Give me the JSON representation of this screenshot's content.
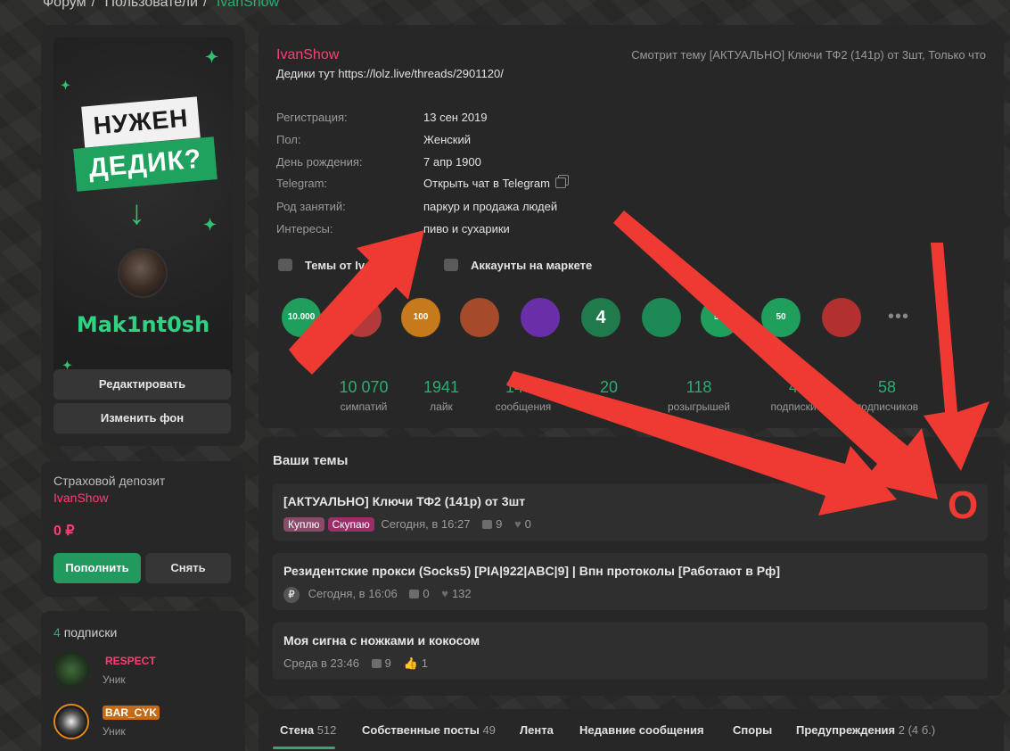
{
  "breadcrumb": [
    "Форум",
    "Пользователи",
    "IvanShow"
  ],
  "banner": {
    "line1": "НУЖЕН",
    "line2": "ДЕДИК?",
    "name": "Mak1nt0sh"
  },
  "left_buttons": {
    "edit": "Редактировать",
    "change_bg": "Изменить фон"
  },
  "deposit": {
    "title": "Страховой депозит",
    "user": "IvanShow",
    "amount": "0 ₽",
    "topup": "Пополнить",
    "withdraw": "Снять"
  },
  "subscriptions": {
    "count": "4",
    "label": "подписки",
    "items": [
      {
        "name": "RESPECT",
        "role": "Уник",
        "color": "#ff3e74"
      },
      {
        "name": "BAR_CYK",
        "role": "Уник",
        "color": "#ffffff"
      }
    ]
  },
  "profile": {
    "username": "IvanShow",
    "status": "Дедики тут https://lolz.live/threads/2901120/",
    "watching": "Смотрит тему [АКТУАЛЬНО] Ключи ТФ2 (141р) от 3шт, Только что",
    "info": [
      {
        "k": "Регистрация:",
        "v": "13 сен 2019"
      },
      {
        "k": "Пол:",
        "v": "Женский"
      },
      {
        "k": "День рождения:",
        "v": "7 апр 1900"
      },
      {
        "k": "Telegram:",
        "v": "Открыть чат в Telegram"
      },
      {
        "k": "Род занятий:",
        "v": "паркур и продажа людей"
      },
      {
        "k": "Интересы:",
        "v": "пиво и сухарики"
      }
    ],
    "link_topics": "Темы от IvanShow",
    "link_market": "Аккаунты на маркете",
    "trophies": [
      {
        "label": "10.000",
        "color": "#1f9e5c"
      },
      {
        "label": "",
        "color": "#b23a3a"
      },
      {
        "label": "100",
        "color": "#c77a1c"
      },
      {
        "label": "",
        "color": "#a54a2a"
      },
      {
        "label": "",
        "color": "#6a2fa8"
      },
      {
        "label": "4",
        "color": "#1f7a4c"
      },
      {
        "label": "",
        "color": "#1d8a55"
      },
      {
        "label": "5.0",
        "color": "#1f9e5c"
      },
      {
        "label": "50",
        "color": "#1f9e5c"
      },
      {
        "label": "",
        "color": "#b23030"
      }
    ],
    "more": "•••",
    "stats": [
      {
        "n": "10 070",
        "l": "симпатий"
      },
      {
        "n": "1941",
        "l": "лайк"
      },
      {
        "n": "1493",
        "l": "сообщения"
      },
      {
        "n": "20",
        "l": "трофеев"
      },
      {
        "n": "118",
        "l": "розыгрышей"
      },
      {
        "n": "4",
        "l": "подписки"
      },
      {
        "n": "58",
        "l": "подписчиков"
      }
    ]
  },
  "threads": {
    "title": "Ваши темы",
    "items": [
      {
        "title": "[АКТУАЛЬНО] Ключи ТФ2 (141р) от 3шт",
        "tags": [
          "Куплю",
          "Скупаю"
        ],
        "date": "Сегодня, в 16:27",
        "replies": "9",
        "likes": "0"
      },
      {
        "title": "Резидентские прокси (Socks5) [PIA|922|ABC|9] | Впн протоколы [Работают в Рф]",
        "date": "Сегодня, в 16:06",
        "replies": "0",
        "likes": "132"
      },
      {
        "title": "Моя сигна с ножками и кокосом",
        "date": "Среда в 23:46",
        "replies": "9",
        "likes": "1"
      }
    ]
  },
  "tabs": [
    {
      "label": "Стена",
      "count": "512"
    },
    {
      "label": "Собственные посты",
      "count": "49"
    },
    {
      "label": "Лента",
      "count": ""
    },
    {
      "label": "Недавние сообщения",
      "count": ""
    },
    {
      "label": "Споры",
      "count": ""
    },
    {
      "label": "Предупреждения",
      "count": "2 (4 б.)"
    }
  ],
  "annotation": {
    "letter": "O",
    "color": "#ee3a33"
  }
}
